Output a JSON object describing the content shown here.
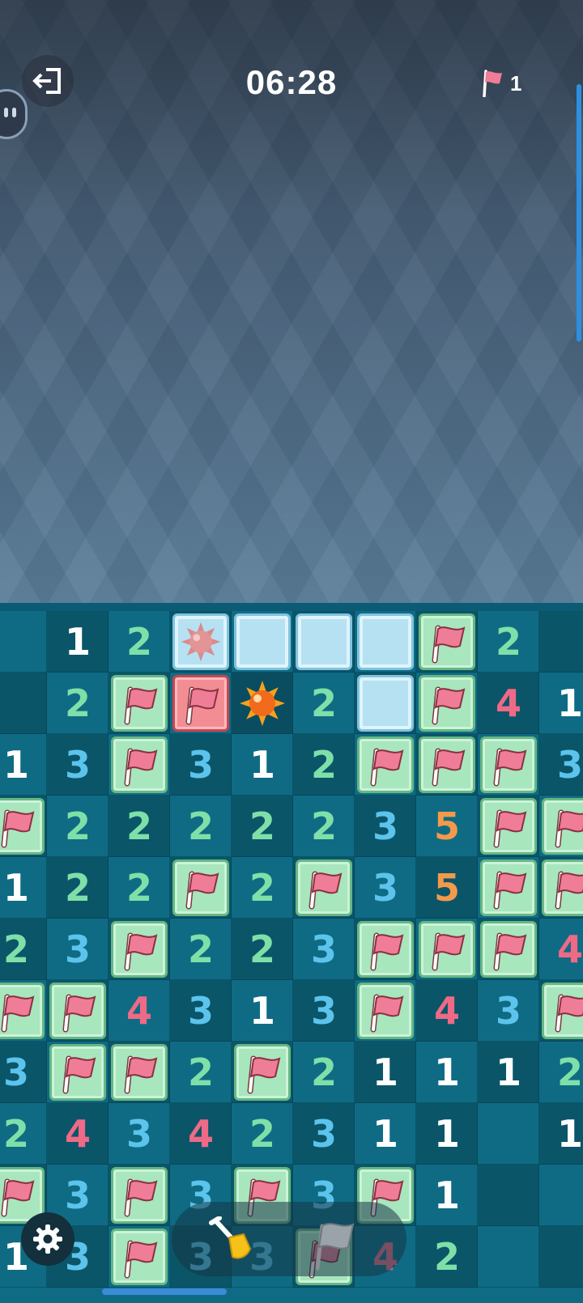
{
  "hud": {
    "timer": "06:28",
    "flags_remaining": "1",
    "exit_icon": "exit-icon",
    "flag_icon": "flag-icon"
  },
  "board": {
    "rows": [
      [
        "",
        "1",
        "2",
        "ice-mine",
        "ice",
        "ice",
        "ice",
        "F",
        "2",
        ""
      ],
      [
        "",
        "2",
        "F",
        "R",
        "mine",
        "2",
        "ice",
        "F",
        "4",
        "1"
      ],
      [
        "1",
        "3",
        "F",
        "3",
        "1",
        "2",
        "F",
        "F",
        "F",
        "3"
      ],
      [
        "F",
        "2",
        "2",
        "2",
        "2",
        "2",
        "3",
        "5",
        "F",
        "F"
      ],
      [
        "1",
        "2",
        "2",
        "F",
        "2",
        "F",
        "3",
        "5",
        "F",
        "F"
      ],
      [
        "2",
        "3",
        "F",
        "2",
        "2",
        "3",
        "F",
        "F",
        "F",
        "4"
      ],
      [
        "F",
        "F",
        "4",
        "3",
        "1",
        "3",
        "F",
        "4",
        "3",
        "F"
      ],
      [
        "3",
        "F",
        "F",
        "2",
        "F",
        "2",
        "1",
        "1",
        "1",
        "2"
      ],
      [
        "2",
        "4",
        "3",
        "4",
        "2",
        "3",
        "1",
        "1",
        "",
        "1"
      ],
      [
        "F",
        "3",
        "F",
        "3",
        "F",
        "3",
        "F",
        "1",
        "",
        ""
      ],
      [
        "1",
        "3",
        "F",
        "3",
        "3",
        "F",
        "4",
        "2",
        "",
        ""
      ]
    ]
  },
  "controls": {
    "settings_icon": "gear-icon",
    "dig_tool_icon": "shovel-icon",
    "flag_tool_icon": "flag-tool-icon"
  }
}
